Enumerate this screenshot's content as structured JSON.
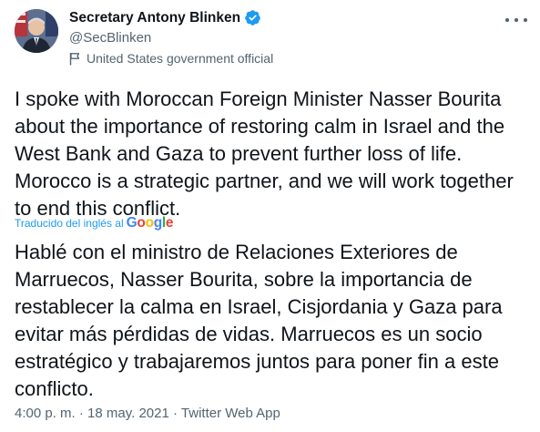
{
  "author": {
    "name": "Secretary Antony Blinken",
    "handle": "@SecBlinken",
    "label": "United States government official"
  },
  "tweet": {
    "text": "I spoke with Moroccan Foreign Minister Nasser Bourita about the importance of restoring calm in Israel and the West Bank and Gaza to prevent further loss of life. Morocco is a strategic partner, and we will work together to end this conflict.",
    "translated_by": "Traducido del inglés al",
    "translator": "Google",
    "translation": "Hablé con el ministro de Relaciones Exteriores de Marruecos, Nasser Bourita, sobre la importancia de restablecer la calma en Israel, Cisjordania y Gaza para evitar más pérdidas de vidas. Marruecos es un socio estratégico y trabajaremos juntos para poner fin a este conflicto."
  },
  "meta": {
    "time": "4:00 p. m.",
    "separator": "·",
    "date": "18 may. 2021",
    "source": "Twitter Web App"
  },
  "colors": {
    "text": "#0f1419",
    "secondary": "#536471",
    "accent": "#1d9bf0"
  },
  "icons": {
    "verified": "verified-badge-icon",
    "label": "flag-icon",
    "more": "more-dots-icon"
  }
}
